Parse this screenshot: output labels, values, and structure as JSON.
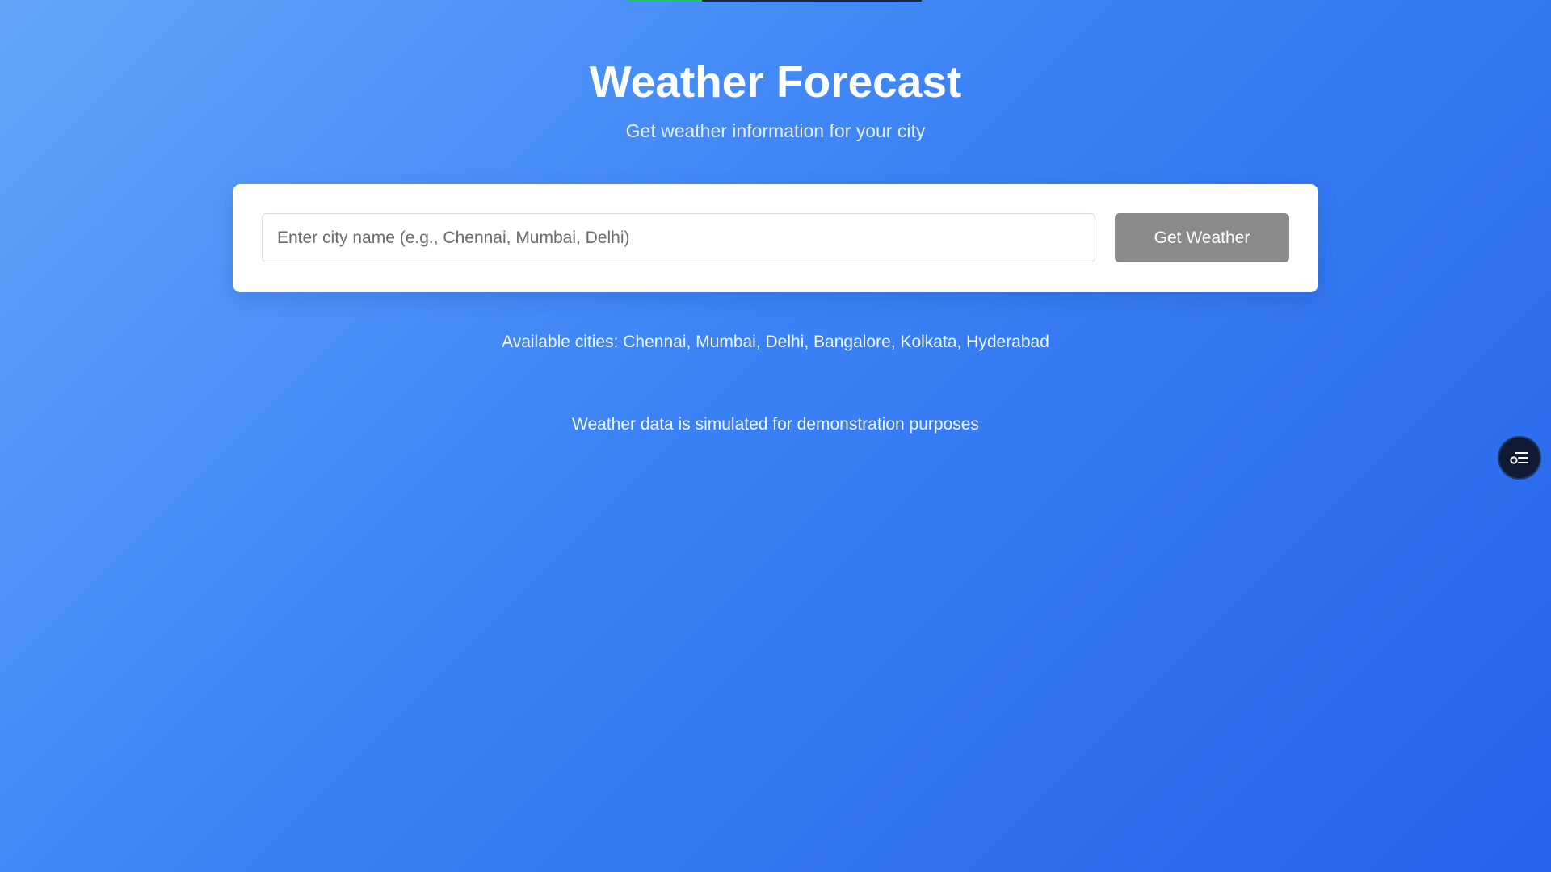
{
  "page": {
    "title": "Weather Forecast",
    "subtitle": "Get weather information for your city"
  },
  "loading_bar": {
    "progress_percent": 25
  },
  "search": {
    "placeholder": "Enter city name (e.g., Chennai, Mumbai, Delhi)",
    "value": "",
    "button_label": "Get Weather"
  },
  "info": {
    "available_cities": "Available cities: Chennai, Mumbai, Delhi, Bangalore, Kolkata, Hyderabad",
    "disclaimer": "Weather data is simulated for demonstration purposes"
  },
  "floating_button": {
    "icon": "filter-list-icon"
  },
  "colors": {
    "background_start": "#60a5fa",
    "background_end": "#2563eb",
    "button": "#8a8a8a",
    "progress_fill": "#22c55e",
    "fab": "#0f1b33"
  }
}
